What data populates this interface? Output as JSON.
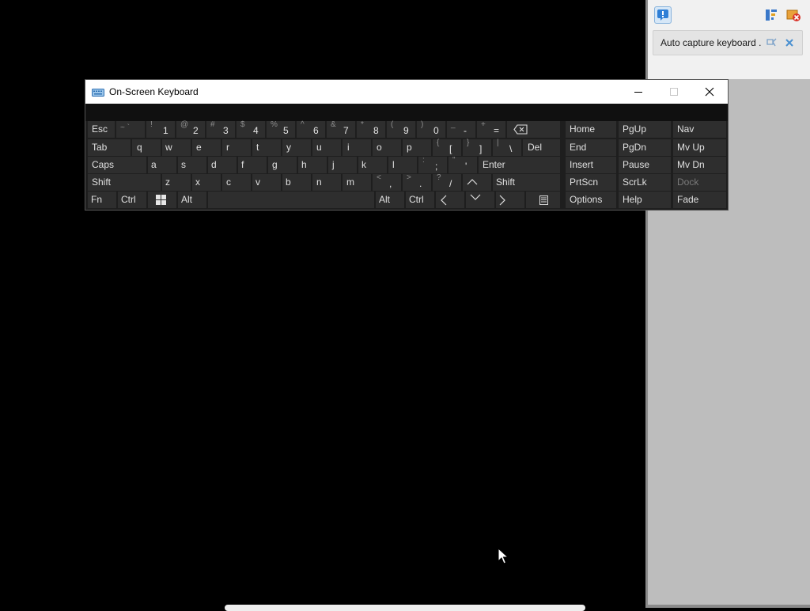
{
  "window": {
    "title": "On-Screen Keyboard"
  },
  "side_panel": {
    "capture_item_label": "Auto capture keyboard ..."
  },
  "keyboard": {
    "row1": [
      {
        "name": "key-esc",
        "label": "Esc"
      },
      {
        "name": "key-backtick",
        "shift": "~ `",
        "main": ""
      },
      {
        "name": "key-1",
        "shift": "!",
        "main": "1"
      },
      {
        "name": "key-2",
        "shift": "@",
        "main": "2"
      },
      {
        "name": "key-3",
        "shift": "#",
        "main": "3"
      },
      {
        "name": "key-4",
        "shift": "$",
        "main": "4"
      },
      {
        "name": "key-5",
        "shift": "%",
        "main": "5"
      },
      {
        "name": "key-6",
        "shift": "^",
        "main": "6"
      },
      {
        "name": "key-7",
        "shift": "&",
        "main": "7"
      },
      {
        "name": "key-8",
        "shift": "*",
        "main": "8"
      },
      {
        "name": "key-9",
        "shift": "(",
        "main": "9"
      },
      {
        "name": "key-0",
        "shift": ")",
        "main": "0"
      },
      {
        "name": "key-minus",
        "shift": "_",
        "main": "-"
      },
      {
        "name": "key-equals",
        "shift": "+",
        "main": "="
      }
    ],
    "row2": [
      {
        "name": "key-tab",
        "label": "Tab"
      },
      {
        "name": "key-q",
        "label": "q"
      },
      {
        "name": "key-w",
        "label": "w"
      },
      {
        "name": "key-e",
        "label": "e"
      },
      {
        "name": "key-r",
        "label": "r"
      },
      {
        "name": "key-t",
        "label": "t"
      },
      {
        "name": "key-y",
        "label": "y"
      },
      {
        "name": "key-u",
        "label": "u"
      },
      {
        "name": "key-i",
        "label": "i"
      },
      {
        "name": "key-o",
        "label": "o"
      },
      {
        "name": "key-p",
        "label": "p"
      },
      {
        "name": "key-lbracket",
        "shift": "{",
        "main": "["
      },
      {
        "name": "key-rbracket",
        "shift": "}",
        "main": "]"
      },
      {
        "name": "key-backslash",
        "shift": "|",
        "main": "\\"
      },
      {
        "name": "key-del",
        "label": "Del"
      }
    ],
    "row3": [
      {
        "name": "key-caps",
        "label": "Caps"
      },
      {
        "name": "key-a",
        "label": "a"
      },
      {
        "name": "key-s",
        "label": "s"
      },
      {
        "name": "key-d",
        "label": "d"
      },
      {
        "name": "key-f",
        "label": "f"
      },
      {
        "name": "key-g",
        "label": "g"
      },
      {
        "name": "key-h",
        "label": "h"
      },
      {
        "name": "key-j",
        "label": "j"
      },
      {
        "name": "key-k",
        "label": "k"
      },
      {
        "name": "key-l",
        "label": "l"
      },
      {
        "name": "key-semicolon",
        "shift": ":",
        "main": ";"
      },
      {
        "name": "key-quote",
        "shift": "\"",
        "main": "'"
      },
      {
        "name": "key-enter",
        "label": "Enter"
      }
    ],
    "row4": [
      {
        "name": "key-shift-left",
        "label": "Shift"
      },
      {
        "name": "key-z",
        "label": "z"
      },
      {
        "name": "key-x",
        "label": "x"
      },
      {
        "name": "key-c",
        "label": "c"
      },
      {
        "name": "key-v",
        "label": "v"
      },
      {
        "name": "key-b",
        "label": "b"
      },
      {
        "name": "key-n",
        "label": "n"
      },
      {
        "name": "key-m",
        "label": "m"
      },
      {
        "name": "key-comma",
        "shift": "<",
        "main": ","
      },
      {
        "name": "key-period",
        "shift": ">",
        "main": "."
      },
      {
        "name": "key-slash",
        "shift": "?",
        "main": "/"
      },
      {
        "name": "key-shift-right",
        "label": "Shift"
      }
    ],
    "row5": [
      {
        "name": "key-fn",
        "label": "Fn"
      },
      {
        "name": "key-ctrl-left",
        "label": "Ctrl"
      },
      {
        "name": "key-alt-left",
        "label": "Alt"
      },
      {
        "name": "key-alt-right",
        "label": "Alt"
      },
      {
        "name": "key-ctrl-right",
        "label": "Ctrl"
      }
    ],
    "nav": [
      {
        "name": "key-home",
        "label": "Home"
      },
      {
        "name": "key-pgup",
        "label": "PgUp"
      },
      {
        "name": "key-nav",
        "label": "Nav"
      },
      {
        "name": "key-end",
        "label": "End"
      },
      {
        "name": "key-pgdn",
        "label": "PgDn"
      },
      {
        "name": "key-mvup",
        "label": "Mv Up"
      },
      {
        "name": "key-insert",
        "label": "Insert"
      },
      {
        "name": "key-pause",
        "label": "Pause"
      },
      {
        "name": "key-mvdn",
        "label": "Mv Dn"
      },
      {
        "name": "key-prtscn",
        "label": "PrtScn"
      },
      {
        "name": "key-scrlk",
        "label": "ScrLk"
      },
      {
        "name": "key-dock",
        "label": "Dock"
      },
      {
        "name": "key-options",
        "label": "Options"
      },
      {
        "name": "key-help",
        "label": "Help"
      },
      {
        "name": "key-fade",
        "label": "Fade"
      }
    ]
  }
}
